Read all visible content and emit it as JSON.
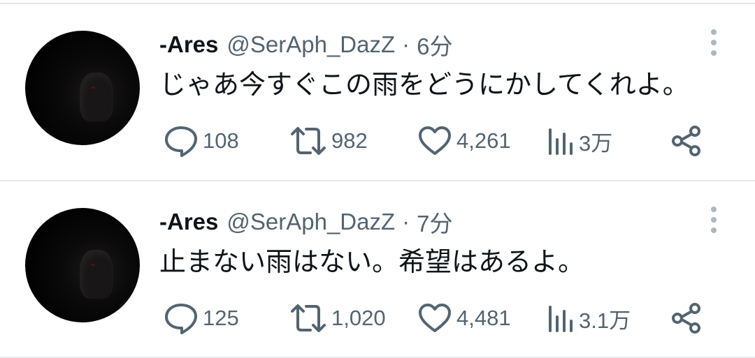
{
  "tweets": [
    {
      "display_name": "-Ares",
      "handle": "@SerAph_DazZ",
      "separator": "·",
      "time": "6分",
      "text": "じゃあ今すぐこの雨をどうにかしてくれよ。",
      "replies": "108",
      "retweets": "982",
      "likes": "4,261",
      "views": "3万"
    },
    {
      "display_name": "-Ares",
      "handle": "@SerAph_DazZ",
      "separator": "·",
      "time": "7分",
      "text": "止まない雨はない。希望はあるよ。",
      "replies": "125",
      "retweets": "1,020",
      "likes": "4,481",
      "views": "3.1万"
    }
  ],
  "icons": {
    "reply": "reply-icon",
    "retweet": "retweet-icon",
    "like": "heart-icon",
    "views": "views-icon",
    "share": "share-icon",
    "more": "more-vertical-icon"
  },
  "colors": {
    "text_primary": "#0f1419",
    "text_secondary": "#536471",
    "divider": "#e6e8ea",
    "more_dots": "#aab8c2"
  }
}
